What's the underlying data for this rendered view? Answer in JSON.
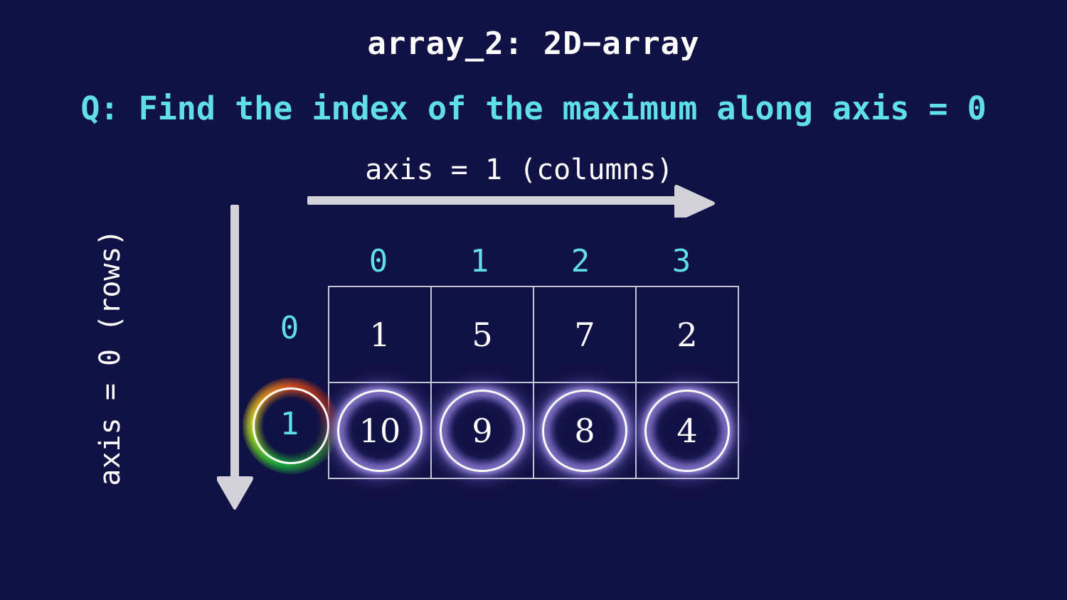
{
  "background_color": "#101144",
  "header": {
    "title": "array_2: 2D−array",
    "question": "Q: Find the index of the maximum along axis = 0",
    "title_color": "#ffffff",
    "question_color": "#5fdfe6"
  },
  "axes": {
    "horizontal_label": "axis = 1 (columns)",
    "vertical_label": "axis = 0 (rows)",
    "arrow_color": "#d2d2d8"
  },
  "matrix": {
    "column_indices": [
      "0",
      "1",
      "2",
      "3"
    ],
    "row_indices": [
      "0",
      "1"
    ],
    "rows": [
      {
        "index": "0",
        "values": [
          "1",
          "5",
          "7",
          "2"
        ],
        "highlighted": false
      },
      {
        "index": "1",
        "values": [
          "10",
          "9",
          "8",
          "4"
        ],
        "highlighted": true
      }
    ],
    "index_color": "#5fdfe6",
    "value_color": "#ffffff",
    "border_color": "#c4c6d4",
    "circle_glow_color": "#9a8adf",
    "answer_row_ring_colors": [
      "#18c23a",
      "#d8e020",
      "#e8521c"
    ]
  },
  "chart_data": {
    "type": "table",
    "title": "array_2: 2D−array",
    "annotation": "Q: Find the index of the maximum along axis = 0",
    "xlabel": "axis = 1 (columns)",
    "ylabel": "axis = 0 (rows)",
    "categories": [
      "0",
      "1",
      "2",
      "3"
    ],
    "row_labels": [
      "0",
      "1"
    ],
    "values": [
      [
        1,
        5,
        7,
        2
      ],
      [
        10,
        9,
        8,
        4
      ]
    ],
    "column_maxima": [
      10,
      9,
      8,
      4
    ],
    "argmax_axis0": [
      1,
      1,
      1,
      1
    ],
    "highlighted_cells": [
      [
        1,
        0
      ],
      [
        1,
        1
      ],
      [
        1,
        2
      ],
      [
        1,
        3
      ]
    ],
    "highlighted_row_index": "1",
    "grid": true,
    "legend": "none"
  }
}
